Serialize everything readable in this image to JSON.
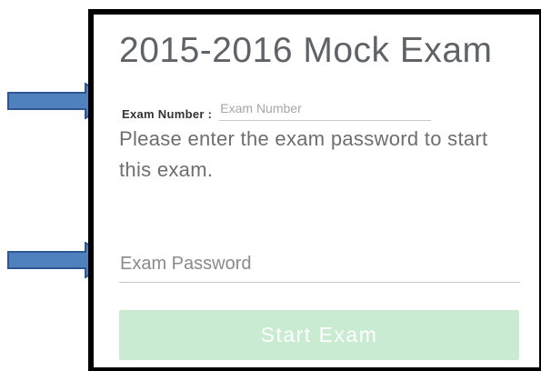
{
  "exam": {
    "title": "2015-2016 Mock Exam",
    "number_label": "Exam Number :",
    "number_placeholder": "Exam Number",
    "number_value": "",
    "instructions": "Please enter the exam password to start this exam.",
    "password_placeholder": "Exam Password",
    "password_value": "",
    "start_label": "Start Exam"
  },
  "annotations": {
    "arrow_color": "#4f81bd",
    "arrow_outline": "#2f5597",
    "icon": "arrow-right-icon"
  },
  "colors": {
    "button_bg": "#c8ebd2",
    "title_text": "#5f6368"
  }
}
